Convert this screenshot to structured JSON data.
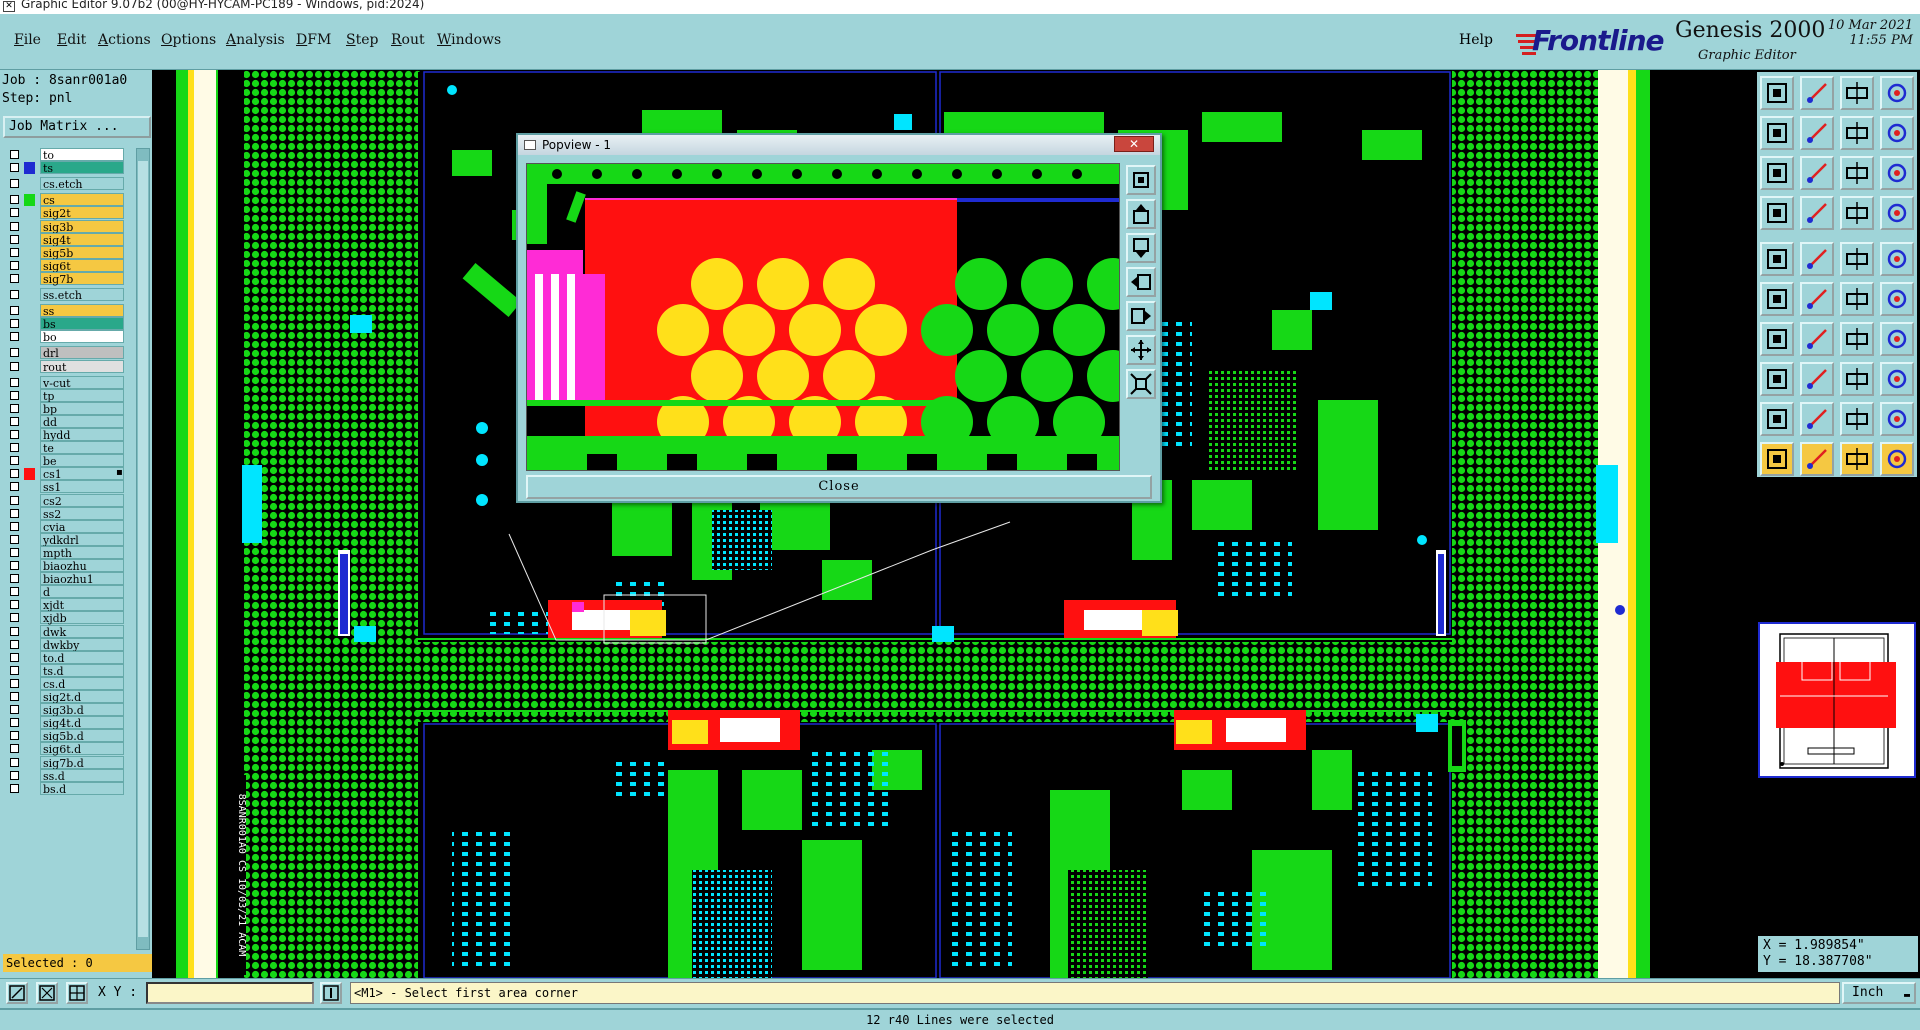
{
  "window": {
    "title": "Graphic Editor 9.07b2 (00@HY-HYCAM-PC189 - Windows, pid:2024)"
  },
  "menu": {
    "items": [
      "File",
      "Edit",
      "Actions",
      "Options",
      "Analysis",
      "DFM",
      "Step",
      "Rout",
      "Windows"
    ],
    "help": "Help"
  },
  "brand": {
    "logo": "Frontline",
    "product": "Genesis 2000",
    "subtitle": "Graphic Editor",
    "date": "10 Mar 2021",
    "time": "11:55 PM"
  },
  "job": {
    "job_line": "Job : 8sanr001a0",
    "step_line": "Step: pnl",
    "job_matrix_label": "Job Matrix ..."
  },
  "layers": [
    {
      "name": "to",
      "bg": "#ffffff",
      "swatch": ""
    },
    {
      "name": "ts",
      "bg": "#2aa88a",
      "swatch": "#1f2bd1"
    },
    {
      "name": "cs.etch",
      "bg": "#9fd4d8",
      "swatch": "",
      "gap": true
    },
    {
      "name": "cs",
      "bg": "#f5c842",
      "swatch": "#16d816",
      "gap": true
    },
    {
      "name": "sig2t",
      "bg": "#f5c842",
      "swatch": ""
    },
    {
      "name": "sig3b",
      "bg": "#f5c842",
      "swatch": ""
    },
    {
      "name": "sig4t",
      "bg": "#f5c842",
      "swatch": ""
    },
    {
      "name": "sig5b",
      "bg": "#f5c842",
      "swatch": ""
    },
    {
      "name": "sig6t",
      "bg": "#f5c842",
      "swatch": ""
    },
    {
      "name": "sig7b",
      "bg": "#f5c842",
      "swatch": ""
    },
    {
      "name": "ss.etch",
      "bg": "#9fd4d8",
      "swatch": "",
      "gap": true
    },
    {
      "name": "ss",
      "bg": "#f5c842",
      "swatch": "",
      "gap": true
    },
    {
      "name": "bs",
      "bg": "#2aa88a",
      "swatch": ""
    },
    {
      "name": "bo",
      "bg": "#ffffff",
      "swatch": ""
    },
    {
      "name": "drl",
      "bg": "#bfbfbf",
      "swatch": "",
      "gap": true
    },
    {
      "name": "rout",
      "bg": "#e0e0e0",
      "swatch": ""
    },
    {
      "name": "v-cut",
      "bg": "#9fd4d8",
      "swatch": "",
      "gap": true
    },
    {
      "name": "tp",
      "bg": "#9fd4d8",
      "swatch": ""
    },
    {
      "name": "bp",
      "bg": "#9fd4d8",
      "swatch": ""
    },
    {
      "name": "dd",
      "bg": "#9fd4d8",
      "swatch": ""
    },
    {
      "name": "hydd",
      "bg": "#9fd4d8",
      "swatch": ""
    },
    {
      "name": "te",
      "bg": "#9fd4d8",
      "swatch": ""
    },
    {
      "name": "be",
      "bg": "#9fd4d8",
      "swatch": ""
    },
    {
      "name": "cs1",
      "bg": "#9fd4d8",
      "swatch": "#ff1010",
      "active": true
    },
    {
      "name": "ss1",
      "bg": "#9fd4d8",
      "swatch": ""
    },
    {
      "name": "cs2",
      "bg": "#9fd4d8",
      "swatch": ""
    },
    {
      "name": "ss2",
      "bg": "#9fd4d8",
      "swatch": ""
    },
    {
      "name": "cvia",
      "bg": "#9fd4d8",
      "swatch": ""
    },
    {
      "name": "ydkdrl",
      "bg": "#9fd4d8",
      "swatch": ""
    },
    {
      "name": "mpth",
      "bg": "#9fd4d8",
      "swatch": ""
    },
    {
      "name": "biaozhu",
      "bg": "#9fd4d8",
      "swatch": ""
    },
    {
      "name": "biaozhu1",
      "bg": "#9fd4d8",
      "swatch": ""
    },
    {
      "name": "d",
      "bg": "#9fd4d8",
      "swatch": ""
    },
    {
      "name": "xjdt",
      "bg": "#9fd4d8",
      "swatch": ""
    },
    {
      "name": "xjdb",
      "bg": "#9fd4d8",
      "swatch": ""
    },
    {
      "name": "dwk",
      "bg": "#9fd4d8",
      "swatch": ""
    },
    {
      "name": "dwkby",
      "bg": "#9fd4d8",
      "swatch": ""
    },
    {
      "name": "to.d",
      "bg": "#9fd4d8",
      "swatch": ""
    },
    {
      "name": "ts.d",
      "bg": "#9fd4d8",
      "swatch": ""
    },
    {
      "name": "cs.d",
      "bg": "#9fd4d8",
      "swatch": ""
    },
    {
      "name": "sig2t.d",
      "bg": "#9fd4d8",
      "swatch": ""
    },
    {
      "name": "sig3b.d",
      "bg": "#9fd4d8",
      "swatch": ""
    },
    {
      "name": "sig4t.d",
      "bg": "#9fd4d8",
      "swatch": ""
    },
    {
      "name": "sig5b.d",
      "bg": "#9fd4d8",
      "swatch": ""
    },
    {
      "name": "sig6t.d",
      "bg": "#9fd4d8",
      "swatch": ""
    },
    {
      "name": "sig7b.d",
      "bg": "#9fd4d8",
      "swatch": ""
    },
    {
      "name": "ss.d",
      "bg": "#9fd4d8",
      "swatch": ""
    },
    {
      "name": "bs.d",
      "bg": "#9fd4d8",
      "swatch": ""
    }
  ],
  "selected": "Selected : 0",
  "coords": {
    "x": "X = 1.989854\"",
    "y": "Y = 18.387708\""
  },
  "bottom": {
    "xy_label": "X Y :",
    "xy_value": "",
    "message": "<M1> - Select first area corner",
    "units": "Inch"
  },
  "status": "12 r40 Lines were selected",
  "popview": {
    "title": "Popview - 1",
    "close_label": "Close",
    "close_x": "✕"
  },
  "canvas": {
    "side_text": "8SANR001A0 CS 10/03/21 ACAM"
  },
  "colors": {
    "panel": "#9fd4d8",
    "copper": "#16d816",
    "mask": "#ff1010",
    "pad": "#ffe01a",
    "silk": "#ffffff",
    "pin": "#ff2bd6",
    "board": "#000000"
  }
}
